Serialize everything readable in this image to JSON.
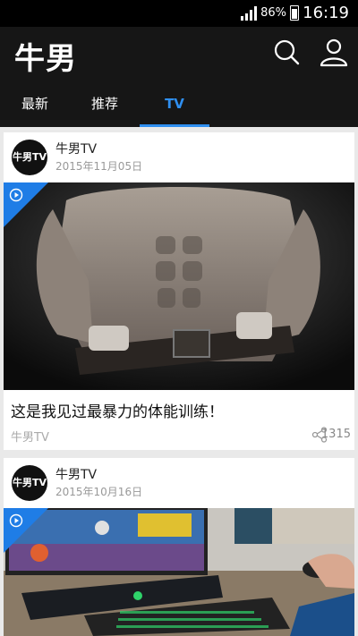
{
  "status_bar": {
    "battery": "86%",
    "time": "16:19"
  },
  "app": {
    "logo": "牛男"
  },
  "icons": {
    "search": "search-icon",
    "user": "user-icon"
  },
  "tabs": [
    {
      "label": "最新"
    },
    {
      "label": "推荐"
    },
    {
      "label": "TV"
    }
  ],
  "active_tab": "TV",
  "colors": {
    "accent": "#2f8ff0",
    "appbar": "#161616",
    "play_corner": "#1f7de6"
  },
  "feed": [
    {
      "avatar_text": "牛男TV",
      "author": "牛男TV",
      "date": "2015年11月05日",
      "title": "这是我见过最暴力的体能训练！",
      "source": "牛男TV",
      "shares": "1315"
    },
    {
      "avatar_text": "牛男TV",
      "author": "牛男TV",
      "date": "2015年10月16日"
    }
  ]
}
